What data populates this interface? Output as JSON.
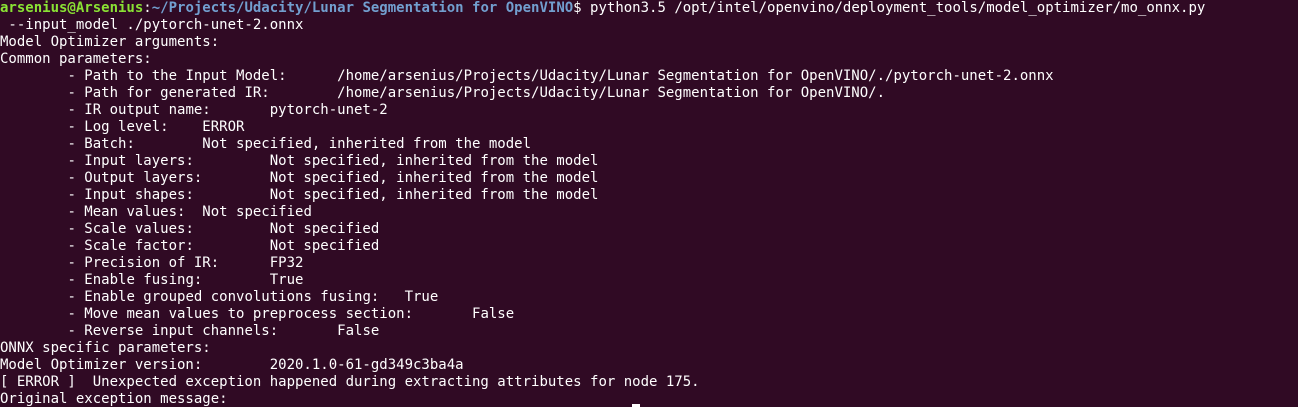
{
  "prompt": {
    "user_host": "arsenius@Arsenius",
    "separator": ":",
    "path": "~/Projects/Udacity/Lunar Segmentation for OpenVINO",
    "symbol": "$",
    "command": " python3.5 /opt/intel/openvino/deployment_tools/model_optimizer/mo_onnx.py",
    "command_cont": " --input_model ./pytorch-unet-2.onnx"
  },
  "output_lines": [
    "Model Optimizer arguments:",
    "Common parameters:",
    "\t- Path to the Input Model: \t/home/arsenius/Projects/Udacity/Lunar Segmentation for OpenVINO/./pytorch-unet-2.onnx",
    "\t- Path for generated IR: \t/home/arsenius/Projects/Udacity/Lunar Segmentation for OpenVINO/.",
    "\t- IR output name: \tpytorch-unet-2",
    "\t- Log level: \tERROR",
    "\t- Batch: \tNot specified, inherited from the model",
    "\t- Input layers: \tNot specified, inherited from the model",
    "\t- Output layers: \tNot specified, inherited from the model",
    "\t- Input shapes: \tNot specified, inherited from the model",
    "\t- Mean values: \tNot specified",
    "\t- Scale values: \tNot specified",
    "\t- Scale factor: \tNot specified",
    "\t- Precision of IR: \tFP32",
    "\t- Enable fusing: \tTrue",
    "\t- Enable grouped convolutions fusing: \tTrue",
    "\t- Move mean values to preprocess section: \tFalse",
    "\t- Reverse input channels: \tFalse",
    "ONNX specific parameters:",
    "Model Optimizer version: \t2020.1.0-61-gd349c3ba4a",
    "[ ERROR ]  Unexpected exception happened during extracting attributes for node 175.",
    "Original exception message: "
  ]
}
